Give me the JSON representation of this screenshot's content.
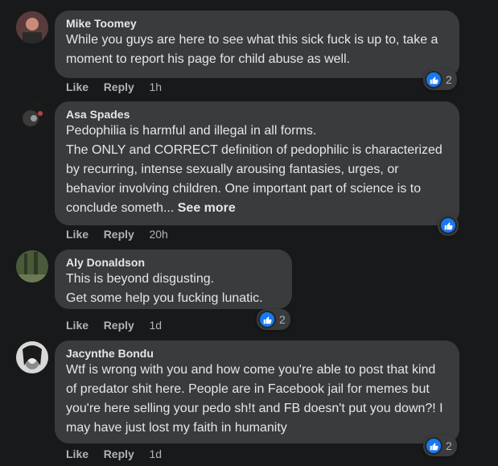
{
  "comments": [
    {
      "author": "Mike Toomey",
      "text": "While you guys are here to see what this sick fuck is up to, take a moment to report his page for child abuse as well.",
      "like_label": "Like",
      "reply_label": "Reply",
      "time": "1h",
      "reaction_count": "2"
    },
    {
      "author": "Asa Spades",
      "text": "Pedophilia is harmful and illegal in all forms.\nThe ONLY and CORRECT definition of pedophilic is characterized by recurring, intense sexually arousing fantasies, urges, or behavior involving children. One important part of science is to conclude someth...",
      "see_more": "See more",
      "like_label": "Like",
      "reply_label": "Reply",
      "time": "20h"
    },
    {
      "author": "Aly Donaldson",
      "text": "This is beyond disgusting.\nGet some help you fucking lunatic.",
      "like_label": "Like",
      "reply_label": "Reply",
      "time": "1d",
      "reaction_count": "2"
    },
    {
      "author": "Jacynthe Bondu",
      "text": "Wtf is wrong with you and how come you're able to post that kind of predator shit here. People are in Facebook jail for memes but you're here selling your pedo sh!t and FB doesn't put you down?! I may have just lost my faith in humanity",
      "like_label": "Like",
      "reply_label": "Reply",
      "time": "1d",
      "reaction_count": "2"
    }
  ],
  "separator": "·",
  "colors": {
    "background": "#18191a",
    "bubble": "#3a3b3c",
    "like_blue": "#1877f2",
    "meta": "#b0b3b8"
  },
  "icons": {
    "reaction": "like-thumb-icon"
  }
}
